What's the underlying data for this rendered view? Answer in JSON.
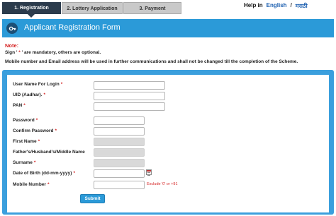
{
  "tabs": [
    {
      "label": "1. Registration",
      "active": true
    },
    {
      "label": "2. Lottery Application",
      "active": false
    },
    {
      "label": "3. Payment",
      "active": false
    }
  ],
  "top_links": {
    "help": "Help in",
    "english": "English",
    "separator": "/",
    "marathi": "मराठी"
  },
  "banner": {
    "title": "Applicant Registration Form",
    "icon": "key-icon",
    "color": "#2b9ad8"
  },
  "note": {
    "title": "Note:",
    "line1_prefix": "Sign '",
    "line1_asterisk": " * ",
    "line1_suffix": "' are mandatory, others are optional.",
    "line2": "Mobile number and Email address will be used in further communications and shall not be changed till the completion of the Scheme."
  },
  "form": {
    "fields": [
      {
        "label": "User Name For Login",
        "required": "*",
        "value": ""
      },
      {
        "label": "UID (Aadhar).",
        "required": "*",
        "value": ""
      },
      {
        "label": "PAN",
        "required": "*",
        "value": ""
      },
      {
        "label": "Password",
        "required": "*",
        "value": ""
      },
      {
        "label": "Confirm Password",
        "required": "*",
        "value": ""
      },
      {
        "label": "First Name",
        "required": "*",
        "value": ""
      },
      {
        "label": "Father's/Husband's/Middle Name",
        "required": "",
        "value": ""
      },
      {
        "label": "Surname",
        "required": "*",
        "value": ""
      },
      {
        "label": "Date of Birth (dd-mm-yyyy)",
        "required": "*",
        "value": ""
      },
      {
        "label": "Mobile Number",
        "required": "*",
        "value": ""
      }
    ],
    "mobile_hint": "Exclude '0' or +91",
    "submit_label": "Submit"
  }
}
